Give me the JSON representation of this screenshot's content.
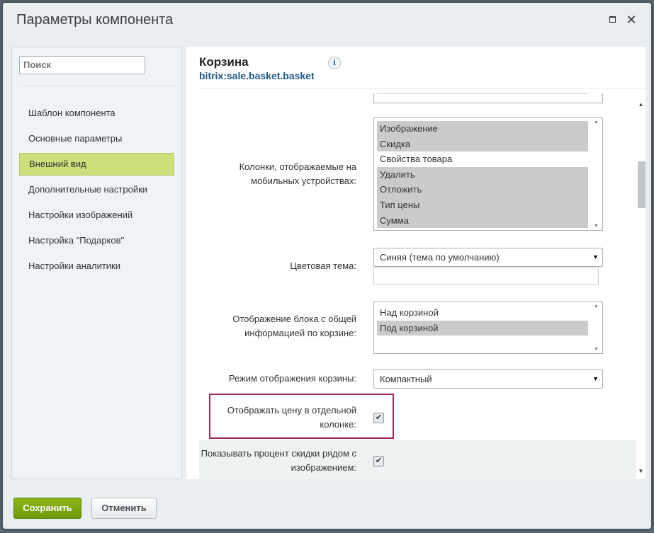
{
  "window": {
    "title": "Параметры компонента",
    "maximize_icon": "maximize-icon",
    "close_icon": "close-icon",
    "close_glyph": "✕"
  },
  "sidebar": {
    "search_placeholder": "Поиск",
    "items": [
      {
        "label": "Шаблон компонента",
        "active": false
      },
      {
        "label": "Основные параметры",
        "active": false
      },
      {
        "label": "Внешний вид",
        "active": true
      },
      {
        "label": "Дополнительные настройки",
        "active": false
      },
      {
        "label": "Настройки изображений",
        "active": false
      },
      {
        "label": "Настройка \"Подарков\"",
        "active": false
      },
      {
        "label": "Настройки аналитики",
        "active": false
      }
    ]
  },
  "component": {
    "title": "Корзина",
    "code": "bitrix:sale.basket.basket",
    "info_glyph": "i"
  },
  "fields": {
    "mobile_columns": {
      "label": "Колонки, отображаемые на мобильных устройствах:",
      "options": [
        {
          "label": "Изображение",
          "selected": true
        },
        {
          "label": "Скидка",
          "selected": true
        },
        {
          "label": "Свойства товара",
          "selected": false
        },
        {
          "label": "Удалить",
          "selected": true
        },
        {
          "label": "Отложить",
          "selected": true
        },
        {
          "label": "Тип цены",
          "selected": true
        },
        {
          "label": "Сумма",
          "selected": true
        }
      ]
    },
    "color_theme": {
      "label": "Цветовая тема:",
      "value": "Синяя (тема по умолчанию)",
      "extra_value": ""
    },
    "summary_block": {
      "label": "Отображение блока с общей информацией по корзине:",
      "options": [
        {
          "label": "Над корзиной",
          "selected": false
        },
        {
          "label": "Под корзиной",
          "selected": true
        }
      ]
    },
    "display_mode": {
      "label": "Режим отображения корзины:",
      "value": "Компактный"
    },
    "price_column": {
      "label": "Отображать цену в отдельной колонке:",
      "checked": true
    },
    "discount_percent": {
      "label": "Показывать процент скидки рядом с изображением:",
      "checked": true
    }
  },
  "footer": {
    "save_label": "Сохранить",
    "cancel_label": "Отменить"
  },
  "colors": {
    "accent_active": "#cbe07a",
    "save_button": "#7aa60e",
    "link_blue": "#1e5b8a",
    "highlight_border": "#9c2c55"
  }
}
